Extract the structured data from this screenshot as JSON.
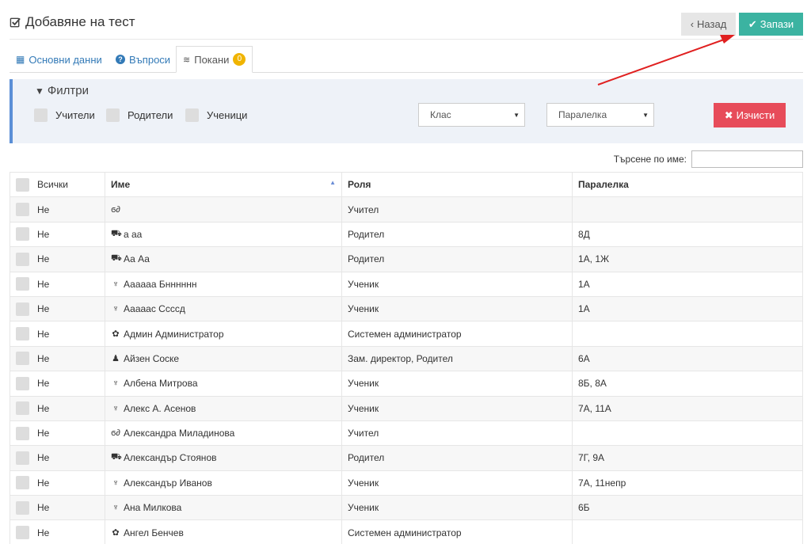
{
  "header": {
    "title": "Добавяне на тест",
    "back_label": "Назад",
    "save_label": "Запази"
  },
  "tabs": [
    {
      "label": "Основни данни",
      "icon": "grid-icon"
    },
    {
      "label": "Въпроси",
      "icon": "question-circle-icon"
    },
    {
      "label": "Покани",
      "icon": "rss-icon",
      "badge": "0"
    }
  ],
  "filters": {
    "title": "Филтри",
    "checkboxes": [
      "Учители",
      "Родители",
      "Ученици"
    ],
    "class_select": "Клас",
    "parallel_select": "Паралелка",
    "clear_label": "Изчисти"
  },
  "search": {
    "label": "Търсене по име:",
    "value": ""
  },
  "table": {
    "headers": [
      "Всички",
      "Име",
      "Роля",
      "Паралелка"
    ],
    "rows": [
      {
        "sel": "Не",
        "icon": "teacher-icon",
        "name": "",
        "role": "Учител",
        "class": ""
      },
      {
        "sel": "Не",
        "icon": "parent-icon",
        "name": "а аа",
        "role": "Родител",
        "class": "8Д"
      },
      {
        "sel": "Не",
        "icon": "parent-icon",
        "name": "Аа Аа",
        "role": "Родител",
        "class": "1А, 1Ж"
      },
      {
        "sel": "Не",
        "icon": "student-icon",
        "name": "Аааааа Бнннннн",
        "role": "Ученик",
        "class": "1А"
      },
      {
        "sel": "Не",
        "icon": "student-icon",
        "name": "Аааааc Ссссд",
        "role": "Ученик",
        "class": "1А"
      },
      {
        "sel": "Не",
        "icon": "admin-gear-icon",
        "name": "Админ Администратор",
        "role": "Системен администратор",
        "class": ""
      },
      {
        "sel": "Не",
        "icon": "user-icon",
        "name": "Айзен Соске",
        "role": "Зам. директор, Родител",
        "class": "6А"
      },
      {
        "sel": "Не",
        "icon": "student-icon",
        "name": "Албена Митрова",
        "role": "Ученик",
        "class": "8Б, 8А"
      },
      {
        "sel": "Не",
        "icon": "student-icon",
        "name": "Алекс А. Асенов",
        "role": "Ученик",
        "class": "7А, 11А"
      },
      {
        "sel": "Не",
        "icon": "teacher-icon",
        "name": "Александра Миладинова",
        "role": "Учител",
        "class": ""
      },
      {
        "sel": "Не",
        "icon": "parent-icon",
        "name": "Александър Стоянов",
        "role": "Родител",
        "class": "7Г, 9А"
      },
      {
        "sel": "Не",
        "icon": "student-icon",
        "name": "Александър Иванов",
        "role": "Ученик",
        "class": "7А, 11непр"
      },
      {
        "sel": "Не",
        "icon": "student-icon",
        "name": "Ана Милкова",
        "role": "Ученик",
        "class": "6Б"
      },
      {
        "sel": "Не",
        "icon": "admin-gear-icon",
        "name": "Ангел Бенчев",
        "role": "Системен администратор",
        "class": ""
      }
    ]
  },
  "colors": {
    "accent_save": "#3bb3a1",
    "clear_button": "#e74c5a",
    "link": "#337ab7",
    "badge": "#f0b400",
    "annotation_arrow": "#e02020"
  }
}
